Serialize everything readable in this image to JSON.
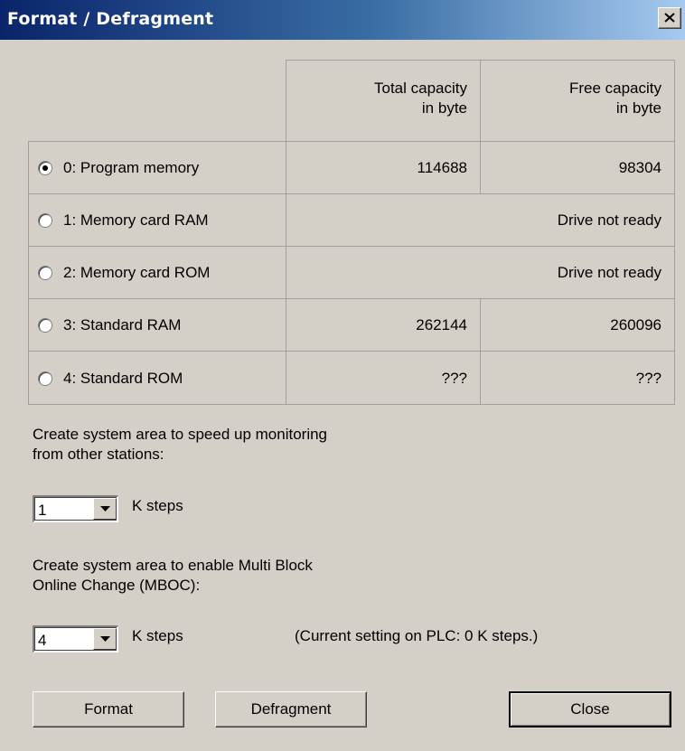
{
  "window": {
    "title": "Format / Defragment",
    "close_icon": "close-x-icon"
  },
  "table": {
    "headers": [
      "Total capacity\nin byte",
      "Free capacity\nin byte"
    ],
    "header_lines": [
      [
        "Total capacity",
        "in byte"
      ],
      [
        "Free capacity",
        "in byte"
      ]
    ],
    "rows": [
      {
        "label": "0: Program memory",
        "selected": true,
        "total": "114688",
        "free": "98304"
      },
      {
        "label": "1: Memory card RAM",
        "selected": false,
        "merged": "Drive not ready"
      },
      {
        "label": "2: Memory card ROM",
        "selected": false,
        "merged": "Drive not ready"
      },
      {
        "label": "3: Standard RAM",
        "selected": false,
        "total": "262144",
        "free": "260096"
      },
      {
        "label": "4: Standard ROM",
        "selected": false,
        "total": "???",
        "free": "???"
      }
    ]
  },
  "monitoring": {
    "text_line1": "Create system area to speed up monitoring",
    "text_line2": "from other stations:",
    "value": "1",
    "unit": "K steps"
  },
  "mboc": {
    "text_line1": "Create system area to enable Multi Block",
    "text_line2": "Online Change (MBOC):",
    "value": "4",
    "unit": "K steps",
    "current_setting": "(Current setting on PLC: 0 K steps.)"
  },
  "buttons": {
    "format": "Format",
    "defragment": "Defragment",
    "close": "Close"
  }
}
